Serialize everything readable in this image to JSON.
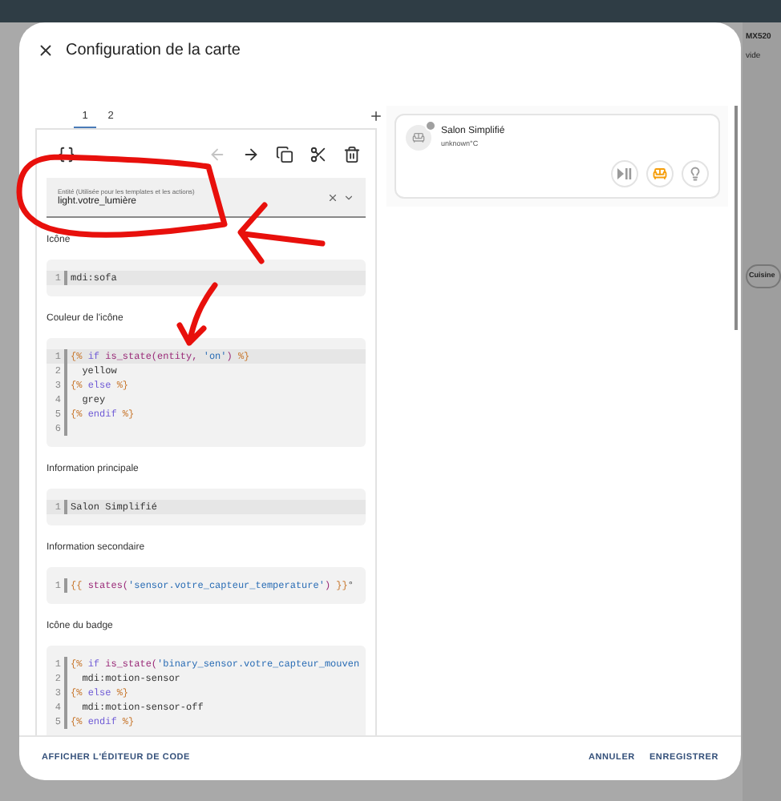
{
  "background": {
    "texts": [
      "MX520",
      "vide"
    ],
    "chip": "Cuisine"
  },
  "dialog": {
    "title": "Configuration de la carte"
  },
  "tabs": [
    {
      "label": "1",
      "selected": true
    },
    {
      "label": "2",
      "selected": false
    }
  ],
  "toolbar": [
    {
      "kind": "code",
      "disabled": false
    },
    {
      "kind": "back",
      "disabled": true
    },
    {
      "kind": "forward",
      "disabled": false
    },
    {
      "kind": "copy",
      "disabled": false
    },
    {
      "kind": "cut",
      "disabled": false
    },
    {
      "kind": "delete",
      "disabled": false
    }
  ],
  "entity_field": {
    "label": "Entité (Utilisée pour les templates et les actions)",
    "value": "light.votre_lumière"
  },
  "fields": [
    {
      "label": "Icône",
      "lines": [
        {
          "num": "1",
          "active": true,
          "segments": [
            {
              "text": "mdi:sofa",
              "kind": "plain"
            }
          ]
        }
      ]
    },
    {
      "label": "Couleur de l'icône",
      "lines": [
        {
          "num": "1",
          "active": true,
          "segments": [
            {
              "text": "{% ",
              "kind": "tag"
            },
            {
              "text": "if ",
              "kind": "keyword"
            },
            {
              "text": "is_state(entity, ",
              "kind": "function"
            },
            {
              "text": "'on'",
              "kind": "string"
            },
            {
              "text": ") ",
              "kind": "function"
            },
            {
              "text": "%}",
              "kind": "tag"
            }
          ]
        },
        {
          "num": "2",
          "active": false,
          "segments": [
            {
              "text": "  yellow",
              "kind": "plain"
            }
          ]
        },
        {
          "num": "3",
          "active": false,
          "segments": [
            {
              "text": "{% ",
              "kind": "tag"
            },
            {
              "text": "else ",
              "kind": "keyword"
            },
            {
              "text": "%}",
              "kind": "tag"
            }
          ]
        },
        {
          "num": "4",
          "active": false,
          "segments": [
            {
              "text": "  grey",
              "kind": "plain"
            }
          ]
        },
        {
          "num": "5",
          "active": false,
          "segments": [
            {
              "text": "{% ",
              "kind": "tag"
            },
            {
              "text": "endif ",
              "kind": "keyword"
            },
            {
              "text": "%}",
              "kind": "tag"
            }
          ]
        },
        {
          "num": "6",
          "active": false
        }
      ]
    },
    {
      "label": "Information principale",
      "lines": [
        {
          "num": "1",
          "active": true,
          "segments": [
            {
              "text": "Salon Simplifié",
              "kind": "plain"
            }
          ]
        }
      ]
    },
    {
      "label": "Information secondaire",
      "lines": [
        {
          "num": "1",
          "active": false,
          "segments": [
            {
              "text": "{{ ",
              "kind": "tag"
            },
            {
              "text": "states(",
              "kind": "function"
            },
            {
              "text": "'sensor.votre_capteur_temperature'",
              "kind": "string"
            },
            {
              "text": ") ",
              "kind": "function"
            },
            {
              "text": "}}",
              "kind": "tag"
            },
            {
              "text": "°",
              "kind": "plain"
            }
          ]
        }
      ]
    },
    {
      "label": "Icône du badge",
      "lines": [
        {
          "num": "1",
          "active": false,
          "segments": [
            {
              "text": "{% ",
              "kind": "tag"
            },
            {
              "text": "if ",
              "kind": "keyword"
            },
            {
              "text": "is_state(",
              "kind": "function"
            },
            {
              "text": "'binary_sensor.votre_capteur_mouven",
              "kind": "string"
            }
          ]
        },
        {
          "num": "2",
          "active": false,
          "segments": [
            {
              "text": "  mdi:motion-sensor",
              "kind": "plain"
            }
          ]
        },
        {
          "num": "3",
          "active": false,
          "segments": [
            {
              "text": "{% ",
              "kind": "tag"
            },
            {
              "text": "else ",
              "kind": "keyword"
            },
            {
              "text": "%}",
              "kind": "tag"
            }
          ]
        },
        {
          "num": "4",
          "active": false,
          "segments": [
            {
              "text": "  mdi:motion-sensor-off",
              "kind": "plain"
            }
          ]
        },
        {
          "num": "5",
          "active": false,
          "segments": [
            {
              "text": "{% ",
              "kind": "tag"
            },
            {
              "text": "endif ",
              "kind": "keyword"
            },
            {
              "text": "%}",
              "kind": "tag"
            }
          ]
        }
      ]
    }
  ],
  "preview": {
    "name": "Salon Simplifié",
    "state": "unknown°C",
    "chips": [
      {
        "kind": "media",
        "active": false
      },
      {
        "kind": "sofa",
        "active": true
      },
      {
        "kind": "bulb",
        "active": false
      }
    ]
  },
  "footer": {
    "code_editor_button": "AFFICHER L'ÉDITEUR DE CODE",
    "buttons": [
      "ANNULER",
      "ENREGISTRER"
    ]
  }
}
